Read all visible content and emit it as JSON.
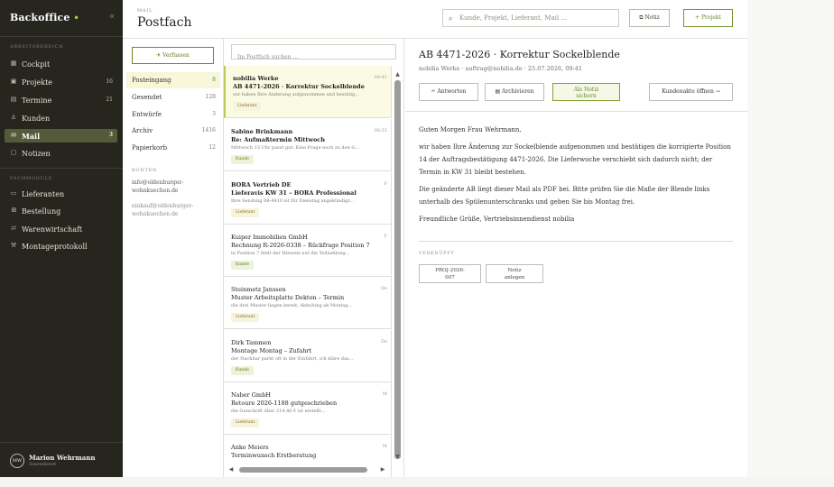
{
  "sidebar": {
    "brand": "Backoffice",
    "brand_dot": "•",
    "collapse_icon": "«",
    "section_work": "ARBEITSBEREICH",
    "section_trade": "FACHMODULE",
    "items": [
      {
        "icon": "▦",
        "label": "Cockpit",
        "count": ""
      },
      {
        "icon": "▣",
        "label": "Projekte",
        "count": "16"
      },
      {
        "icon": "▤",
        "label": "Termine",
        "count": "21"
      },
      {
        "icon": "♙",
        "label": "Kunden",
        "count": ""
      },
      {
        "icon": "✉",
        "label": "Mail",
        "count": "3"
      },
      {
        "icon": "▢",
        "label": "Notizen",
        "count": ""
      }
    ],
    "trade_items": [
      {
        "icon": "▭",
        "label": "Lieferanten"
      },
      {
        "icon": "⊞",
        "label": "Bestellung"
      },
      {
        "icon": "⇄",
        "label": "Warenwirtschaft"
      },
      {
        "icon": "⚒",
        "label": "Montageprotokoll"
      }
    ],
    "user": {
      "initials": "MW",
      "name": "Marion Wehrmann",
      "role": "Innendienst"
    }
  },
  "header": {
    "crumb": "MAIL",
    "title": "Postfach",
    "search_placeholder": "Kunde, Projekt, Lieferant, Mail ...",
    "note_label": "⧉ Notiz",
    "project_label": "+ Projekt"
  },
  "folders": {
    "compose": "✈ Verfassen",
    "items": [
      {
        "label": "Posteingang",
        "count": "8"
      },
      {
        "label": "Gesendet",
        "count": "128"
      },
      {
        "label": "Entwürfe",
        "count": "3"
      },
      {
        "label": "Archiv",
        "count": "1416"
      },
      {
        "label": "Papierkorb",
        "count": "12"
      }
    ],
    "accounts_label": "KONTEN",
    "accounts": [
      "info@oldenburger-wohnkuechen.de",
      "einkauf@oldenburger-wohnkuechen.de"
    ]
  },
  "list": {
    "search_placeholder": "Im Postfach suchen ...",
    "messages": [
      {
        "sender": "nobilia Werke",
        "time": "09:41",
        "subject": "AB 4471-2026 · Korrektur Sockelblende",
        "preview": "wir haben Ihre Änderung aufgenommen und bestätig...",
        "tag": "Lieferant"
      },
      {
        "sender": "Sabine Brinkmann",
        "time": "08:53",
        "subject": "Re: Aufmaßtermin Mittwoch",
        "preview": "Mittwoch 13 Uhr passt gut. Eine Frage noch zu den G...",
        "tag": "Kunde"
      },
      {
        "sender": "BORA Vertrieb DE",
        "time": "F",
        "subject": "Lieferavis KW 31 – BORA Professional",
        "preview": "Ihre Sendung 88-4410 ist für Dienstag angekündigt...",
        "tag": "Lieferant"
      },
      {
        "sender": "Kuiper Immobilien GmbH",
        "time": "F",
        "subject": "Rechnung R-2026-0338 – Rückfrage Position 7",
        "preview": "in Position 7 fehlt der Hinweis auf die Teilzahlung...",
        "tag": "Kunde"
      },
      {
        "sender": "Steinmetz Janssen",
        "time": "Do",
        "subject": "Muster Arbeitsplatte Dekton – Termin",
        "preview": "die drei Muster liegen bereit, Abholung ab Montag...",
        "tag": "Lieferant"
      },
      {
        "sender": "Dirk Tammen",
        "time": "Do",
        "subject": "Montage Montag – Zufahrt",
        "preview": "der Nachbar parkt oft in der Einfahrt, ich kläre das...",
        "tag": "Kunde"
      },
      {
        "sender": "Naber GmbH",
        "time": "M",
        "subject": "Retoure 2026-1188 gutgeschrieben",
        "preview": "die Gutschrift über 218,40 € ist erstellt...",
        "tag": "Lieferant"
      },
      {
        "sender": "Anke Meiers",
        "time": "M",
        "subject": "Terminwunsch Erstberatung",
        "preview": "",
        "tag": ""
      }
    ]
  },
  "reader": {
    "subject": "AB 4471-2026 · Korrektur Sockelblende",
    "meta": "nobilia Werke · auftrag@nobilia.de · 25.07.2026, 09:41",
    "reply": "↶ Antworten",
    "archive": "▤ Archivieren",
    "save_note_line1": "Als Notiz",
    "save_note_line2": "sichern",
    "customer_file": "Kundenakte öffnen →",
    "greeting": "Guten Morgen Frau Wehrmann,",
    "p1": "wir haben Ihre Änderung zur Sockelblende aufgenommen und bestätigen die korrigierte Position 14 der Auftragsbestätigung 4471-2026. Die Lieferwoche verschiebt sich dadurch nicht; der Termin in KW 31 bleibt bestehen.",
    "p2": "Die geänderte AB liegt dieser Mail als PDF bei. Bitte prüfen Sie die Maße der Blende links unterhalb des Spülenunterschranks und geben Sie bis Montag frei.",
    "closing": "Freundliche Grüße, Vertriebsinnendienst nobilia",
    "linked_label": "VERKNÜPFT",
    "chip1_line1": "PROJ-2026-",
    "chip1_line2": "007",
    "chip2_line1": "Notiz",
    "chip2_line2": "anlegen"
  },
  "colors": {
    "sidebar": "#26261f",
    "accent": "#6d8d22",
    "active_nav": "#535b3a"
  }
}
